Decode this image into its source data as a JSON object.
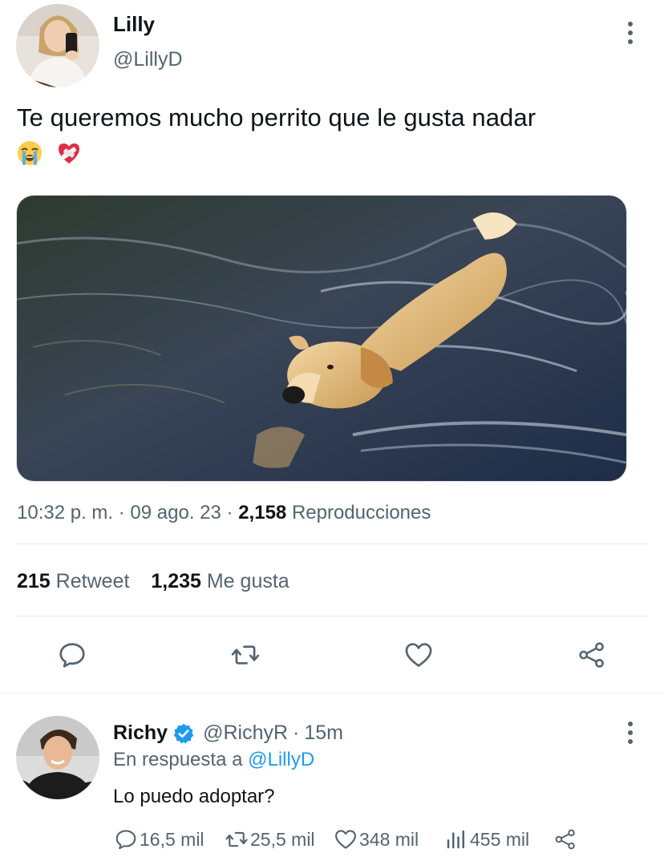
{
  "tweet": {
    "author_name": "Lilly",
    "author_handle": "@LillyD",
    "text": "Te queremos mucho perrito que le gusta nadar",
    "emojis": [
      "loudly-crying-face",
      "mending-heart"
    ],
    "image_alt": "golden retriever swimming",
    "time": "10:32 p. m.",
    "date": "09 ago. 23",
    "separator": "·",
    "views_count": "2,158",
    "views_label": "Reproducciones",
    "retweets_count": "215",
    "retweets_label": "Retweet",
    "likes_count": "1,235",
    "likes_label": "Me gusta"
  },
  "actions": {
    "reply_icon": "reply-icon",
    "retweet_icon": "retweet-icon",
    "like_icon": "heart-icon",
    "share_icon": "share-icon"
  },
  "reply": {
    "author_name": "Richy",
    "verified": true,
    "author_handle": "@RichyR",
    "separator": "·",
    "time": "15m",
    "in_reply_prefix": "En respuesta a",
    "in_reply_handle": "@LillyD",
    "text": "Lo puedo adoptar?",
    "reply_count": "16,5 mil",
    "retweet_count": "25,5 mil",
    "like_count": "348 mil",
    "view_count": "455 mil"
  },
  "colors": {
    "accent": "#1d9bf0",
    "text_primary": "#0f1419",
    "text_secondary": "#536471",
    "divider": "#e6ecf0"
  }
}
